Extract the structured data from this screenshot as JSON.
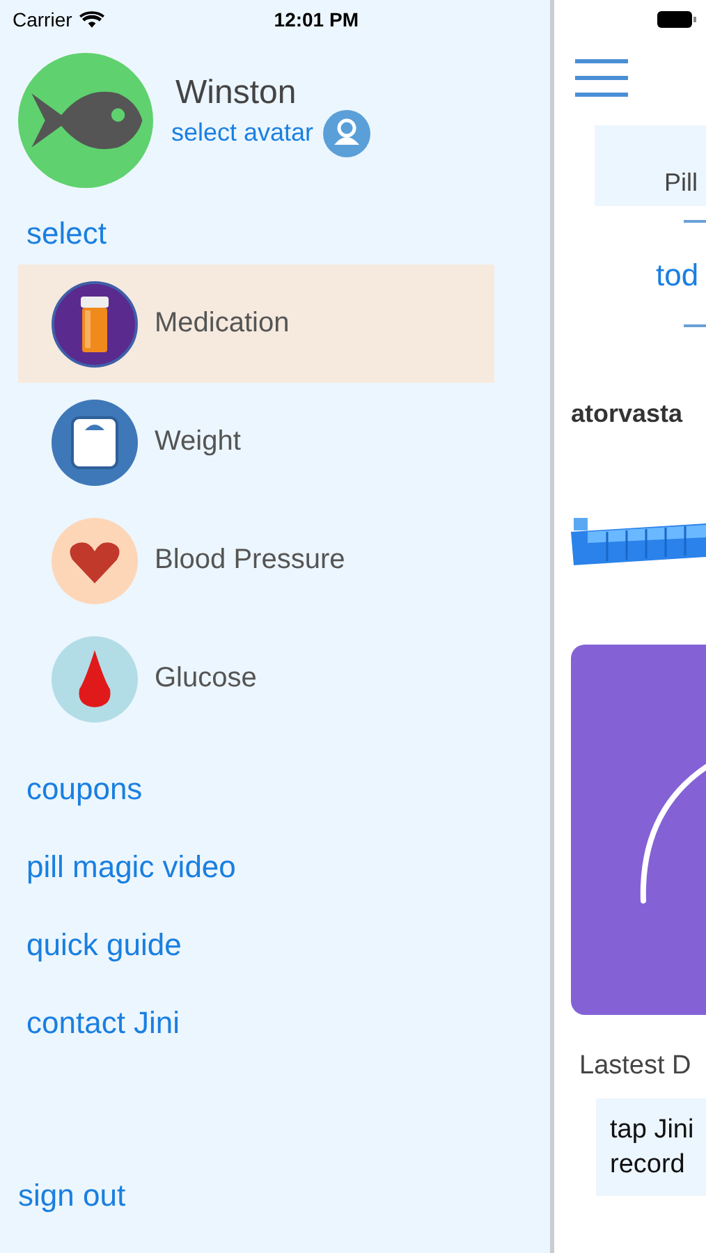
{
  "status_bar": {
    "carrier": "Carrier",
    "time": "12:01 PM"
  },
  "profile": {
    "name": "Winston",
    "select_avatar": "select avatar"
  },
  "section_label": "select",
  "menu": [
    {
      "label": "Medication",
      "kind": "pill-bottle",
      "selected": true
    },
    {
      "label": "Weight",
      "kind": "scale",
      "selected": false
    },
    {
      "label": "Blood Pressure",
      "kind": "heart",
      "selected": false
    },
    {
      "label": "Glucose",
      "kind": "drop",
      "selected": false
    }
  ],
  "links": [
    "coupons",
    "pill magic video",
    "quick guide",
    "contact Jini"
  ],
  "sign_out": "sign out",
  "main": {
    "tab": "Pill",
    "subtab": "tod",
    "medicine": "atorvasta",
    "latest_label": "Lastest D",
    "hint_lines": [
      "tap Jini",
      "record"
    ]
  }
}
